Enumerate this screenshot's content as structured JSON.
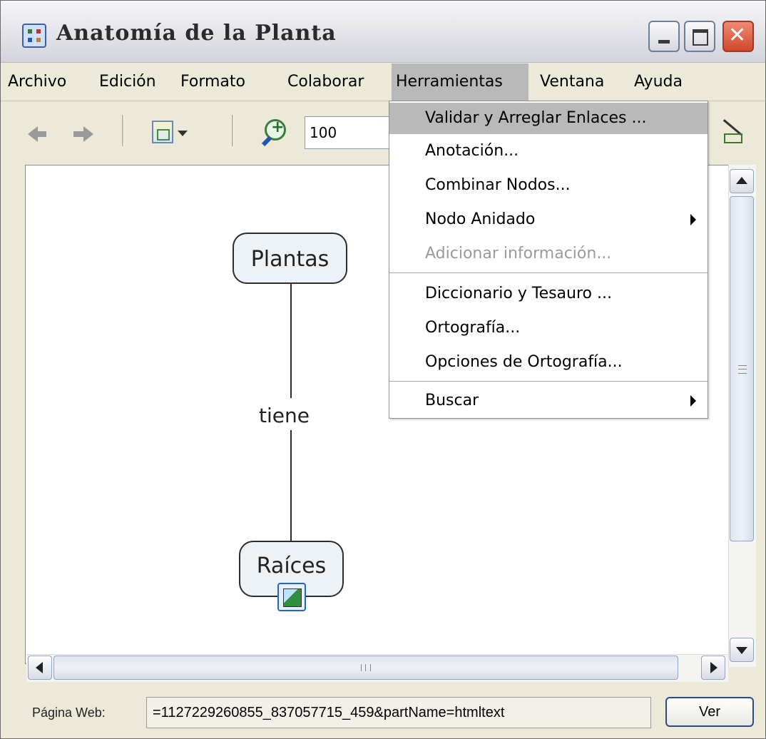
{
  "window": {
    "title": "Anatomía de la Planta"
  },
  "menubar": {
    "items": [
      "Archivo",
      "Edición",
      "Formato",
      "Colaborar",
      "Herramientas",
      "Ventana",
      "Ayuda"
    ],
    "active": "Herramientas"
  },
  "toolbar": {
    "zoom_value": "100"
  },
  "canvas": {
    "nodes": {
      "top": "Plantas",
      "bottom": "Raíces"
    },
    "link_label": "tiene"
  },
  "dropdown": {
    "items": [
      {
        "label": "Validar y Arreglar Enlaces ...",
        "highlighted": true
      },
      {
        "label": "Anotación..."
      },
      {
        "label": "Combinar Nodos..."
      },
      {
        "label": "Nodo Anidado",
        "submenu": true
      },
      {
        "label": "Adicionar información...",
        "disabled": true
      },
      {
        "label": "Diccionario y Tesauro ..."
      },
      {
        "label": "Ortografía..."
      },
      {
        "label": "Opciones de Ortografía..."
      },
      {
        "label": "Buscar",
        "submenu": true
      }
    ]
  },
  "status": {
    "web_label": "Página Web:",
    "web_value": "=1127229260855_837057715_459&partName=htmltext",
    "ver_label": "Ver"
  },
  "colors": {
    "menu_active_bg": "#B9B9B9",
    "node_bg": "#ECF2F5",
    "chrome_bg": "#ECE9D8"
  }
}
